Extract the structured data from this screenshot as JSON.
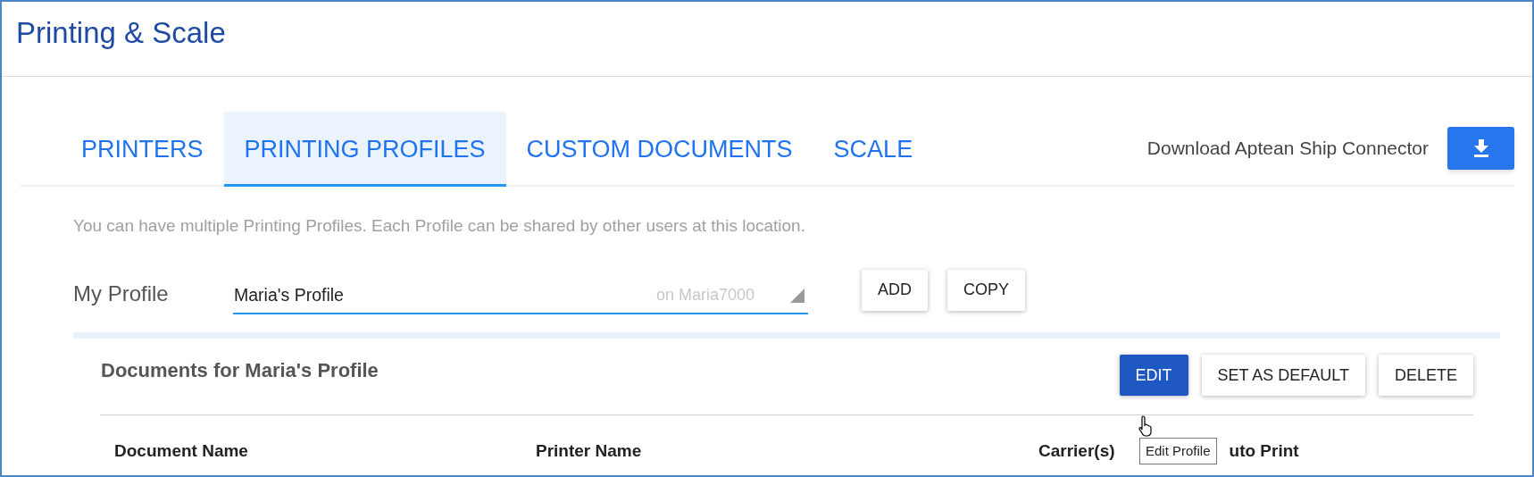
{
  "window": {
    "title": "Printing & Scale"
  },
  "tabs": [
    {
      "label": "PRINTERS",
      "selected": false
    },
    {
      "label": "PRINTING PROFILES",
      "selected": true
    },
    {
      "label": "CUSTOM DOCUMENTS",
      "selected": false
    },
    {
      "label": "SCALE",
      "selected": false
    }
  ],
  "download": {
    "label": "Download Aptean Ship Connector"
  },
  "description": "You can have multiple Printing Profiles. Each Profile can be shared by other users at this location.",
  "profile": {
    "label": "My Profile",
    "value": "Maria's Profile",
    "location": "on Maria7000",
    "buttons": [
      "ADD",
      "COPY"
    ]
  },
  "documents": {
    "title": "Documents for Maria's Profile",
    "buttons": [
      {
        "label": "EDIT",
        "kind": "primary"
      },
      {
        "label": "SET AS DEFAULT",
        "kind": "plain"
      },
      {
        "label": "DELETE",
        "kind": "plain"
      }
    ],
    "tooltip": "Edit Profile",
    "columns": [
      "Document Name",
      "Printer Name",
      "Carrier(s)",
      "uto Print"
    ]
  }
}
